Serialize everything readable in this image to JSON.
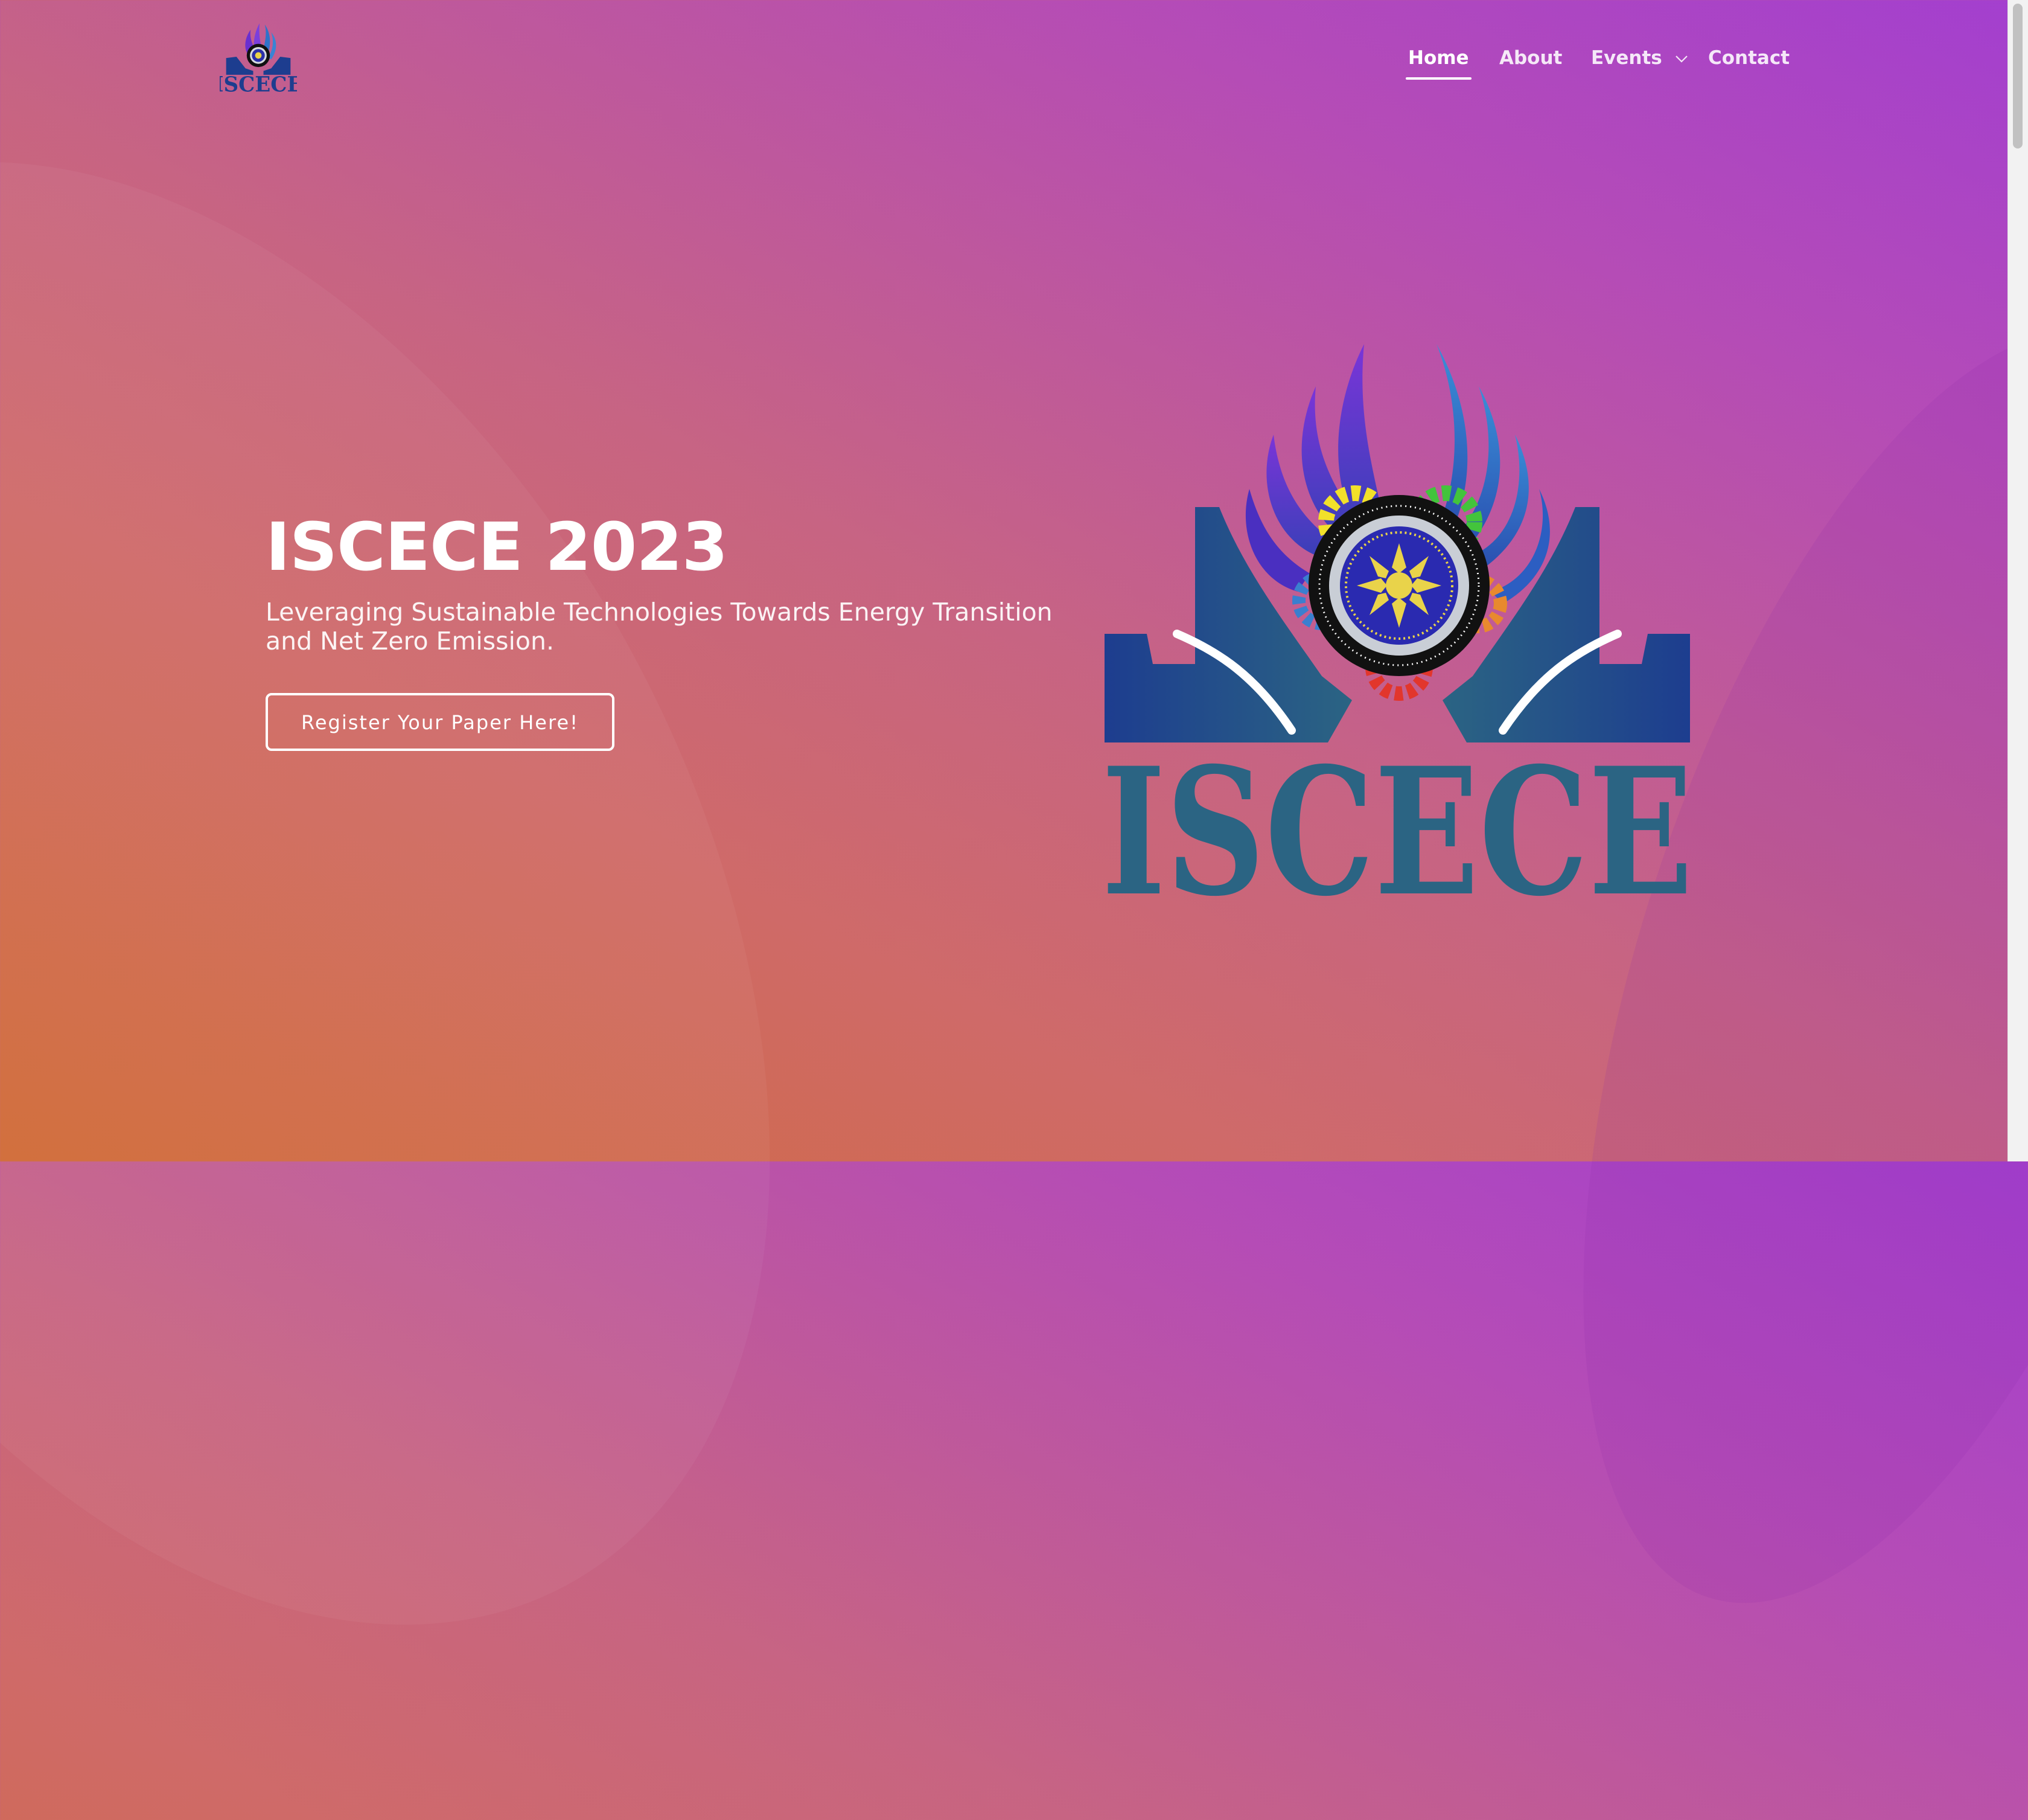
{
  "logo": {
    "text": "ISCECE"
  },
  "nav": {
    "home": "Home",
    "about": "About",
    "events": "Events",
    "contact": "Contact"
  },
  "hero": {
    "title": "ISCECE 2023",
    "subtitle": "Leveraging Sustainable Technologies Towards Energy Transition and Net Zero Emission.",
    "cta": "Register Your Paper Here!"
  },
  "colors": {
    "logo_teal": "#2b6483",
    "logo_navy": "#1d3d8f",
    "flame_purple": "#6a2fd0",
    "flame_blue": "#2f73c9"
  }
}
